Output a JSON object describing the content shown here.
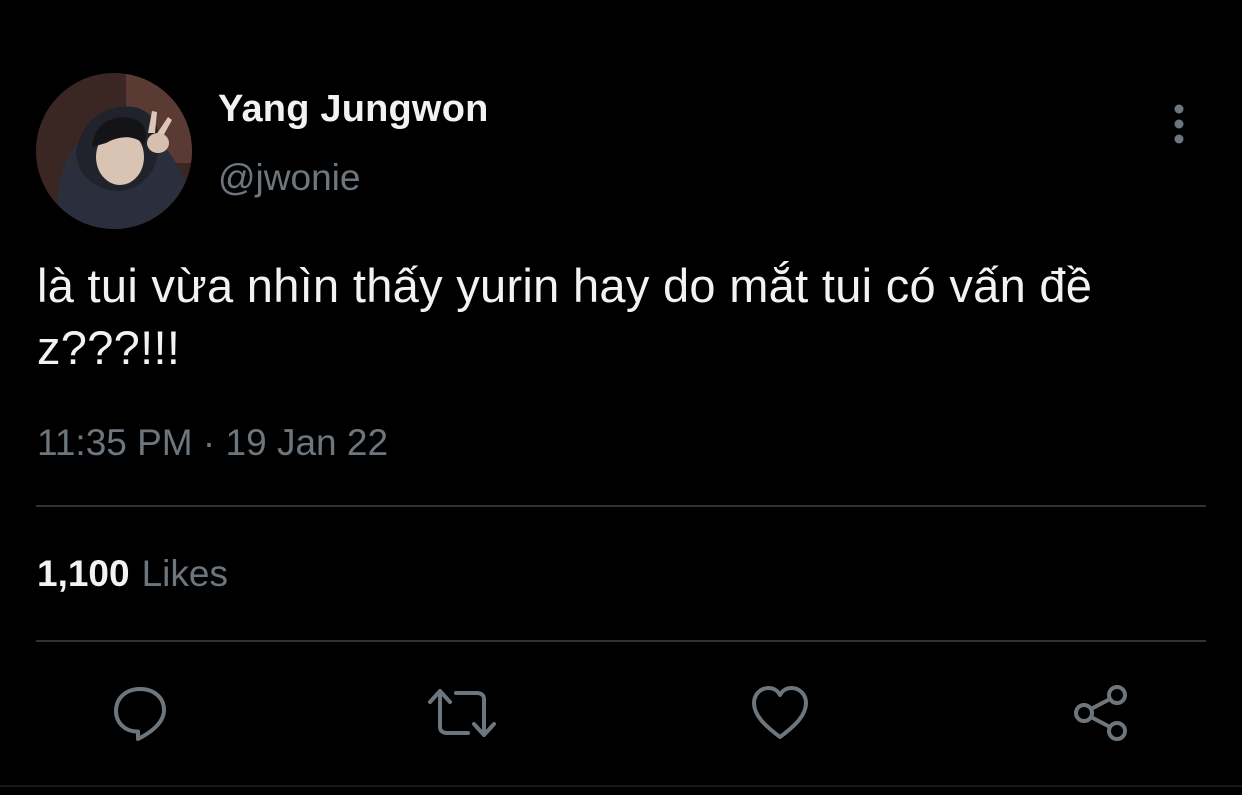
{
  "user": {
    "display_name": "Yang Jungwon",
    "handle": "@jwonie",
    "avatar_icon": "profile-photo"
  },
  "tweet": {
    "text": "là tui vừa nhìn thấy yurin hay do mắt tui có vấn đề z???!!!",
    "timestamp": "11:35 PM · 19 Jan 22"
  },
  "stats": {
    "likes_count": "1,100",
    "likes_label": "Likes"
  },
  "actions": {
    "reply_icon": "speech-bubble-icon",
    "retweet_icon": "retweet-icon",
    "like_icon": "heart-icon",
    "share_icon": "share-icon",
    "more_icon": "vertical-dots-icon"
  },
  "colors": {
    "background": "#000000",
    "primary_text": "#f2f2f2",
    "secondary_text": "#6e767d",
    "divider": "#2f3336",
    "icon": "#6e767d"
  }
}
